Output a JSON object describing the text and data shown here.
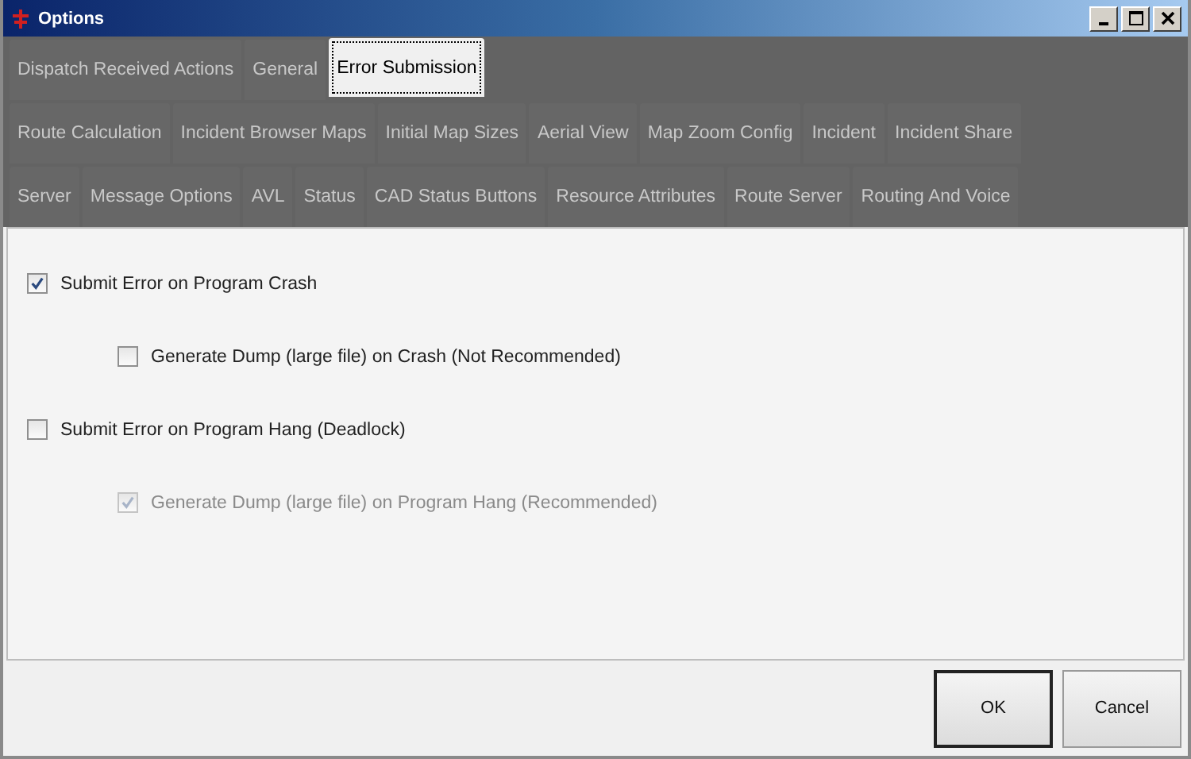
{
  "window": {
    "title": "Options"
  },
  "tab_rows": [
    [
      {
        "label": "Dispatch Received Actions",
        "selected": false
      },
      {
        "label": "General",
        "selected": false
      },
      {
        "label": "Error Submission",
        "selected": true
      }
    ],
    [
      {
        "label": "Route Calculation",
        "selected": false
      },
      {
        "label": "Incident Browser Maps",
        "selected": false
      },
      {
        "label": "Initial Map Sizes",
        "selected": false
      },
      {
        "label": "Aerial View",
        "selected": false
      },
      {
        "label": "Map Zoom Config",
        "selected": false
      },
      {
        "label": "Incident",
        "selected": false
      },
      {
        "label": "Incident Share",
        "selected": false
      }
    ],
    [
      {
        "label": "Server",
        "selected": false
      },
      {
        "label": "Message Options",
        "selected": false
      },
      {
        "label": "AVL",
        "selected": false
      },
      {
        "label": "Status",
        "selected": false
      },
      {
        "label": "CAD Status Buttons",
        "selected": false
      },
      {
        "label": "Resource Attributes",
        "selected": false
      },
      {
        "label": "Route Server",
        "selected": false
      },
      {
        "label": "Routing And Voice",
        "selected": false
      }
    ]
  ],
  "options": [
    {
      "label": "Submit Error on Program Crash",
      "checked": true,
      "disabled": false,
      "children": [
        {
          "label": "Generate Dump (large file) on Crash (Not Recommended)",
          "checked": false,
          "disabled": false
        }
      ]
    },
    {
      "label": "Submit Error on Program Hang (Deadlock)",
      "checked": false,
      "disabled": false,
      "children": [
        {
          "label": "Generate Dump (large file) on Program Hang (Recommended)",
          "checked": true,
          "disabled": true
        }
      ]
    }
  ],
  "buttons": [
    {
      "label": "OK",
      "kind": "default"
    },
    {
      "label": "Cancel",
      "kind": "normal"
    }
  ]
}
